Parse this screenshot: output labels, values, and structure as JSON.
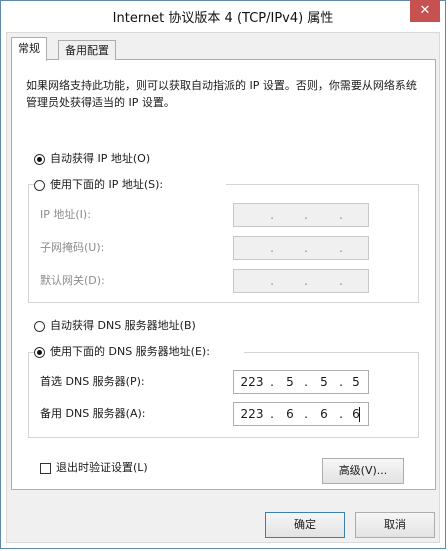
{
  "window": {
    "title": "Internet 协议版本 4 (TCP/IPv4) 属性",
    "close_glyph": "✕"
  },
  "tabs": [
    {
      "label": "常规",
      "selected": true
    },
    {
      "label": "备用配置",
      "selected": false
    }
  ],
  "description": "如果网络支持此功能，则可以获取自动指派的 IP 设置。否则，你需要从网络系统管理员处获得适当的 IP 设置。",
  "ip_section": {
    "auto_label": "自动获得 IP 地址(O)",
    "auto_selected": true,
    "manual_label": "使用下面的 IP 地址(S):",
    "manual_selected": false,
    "fields": [
      {
        "label": "IP 地址(I):",
        "octets": [
          "",
          "",
          "",
          ""
        ],
        "enabled": false
      },
      {
        "label": "子网掩码(U):",
        "octets": [
          "",
          "",
          "",
          ""
        ],
        "enabled": false
      },
      {
        "label": "默认网关(D):",
        "octets": [
          "",
          "",
          "",
          ""
        ],
        "enabled": false
      }
    ]
  },
  "dns_section": {
    "auto_label": "自动获得 DNS 服务器地址(B)",
    "auto_selected": false,
    "manual_label": "使用下面的 DNS 服务器地址(E):",
    "manual_selected": true,
    "preferred": {
      "label": "首选 DNS 服务器(P):",
      "octets": [
        "223",
        "5",
        "5",
        "5"
      ]
    },
    "alternate": {
      "label": "备用 DNS 服务器(A):",
      "octets": [
        "223",
        "6",
        "6",
        "6"
      ]
    }
  },
  "validate_on_exit": {
    "label": "退出时验证设置(L)",
    "checked": false
  },
  "buttons": {
    "advanced": "高级(V)...",
    "ok": "确定",
    "cancel": "取消"
  },
  "dot_glyph": "."
}
